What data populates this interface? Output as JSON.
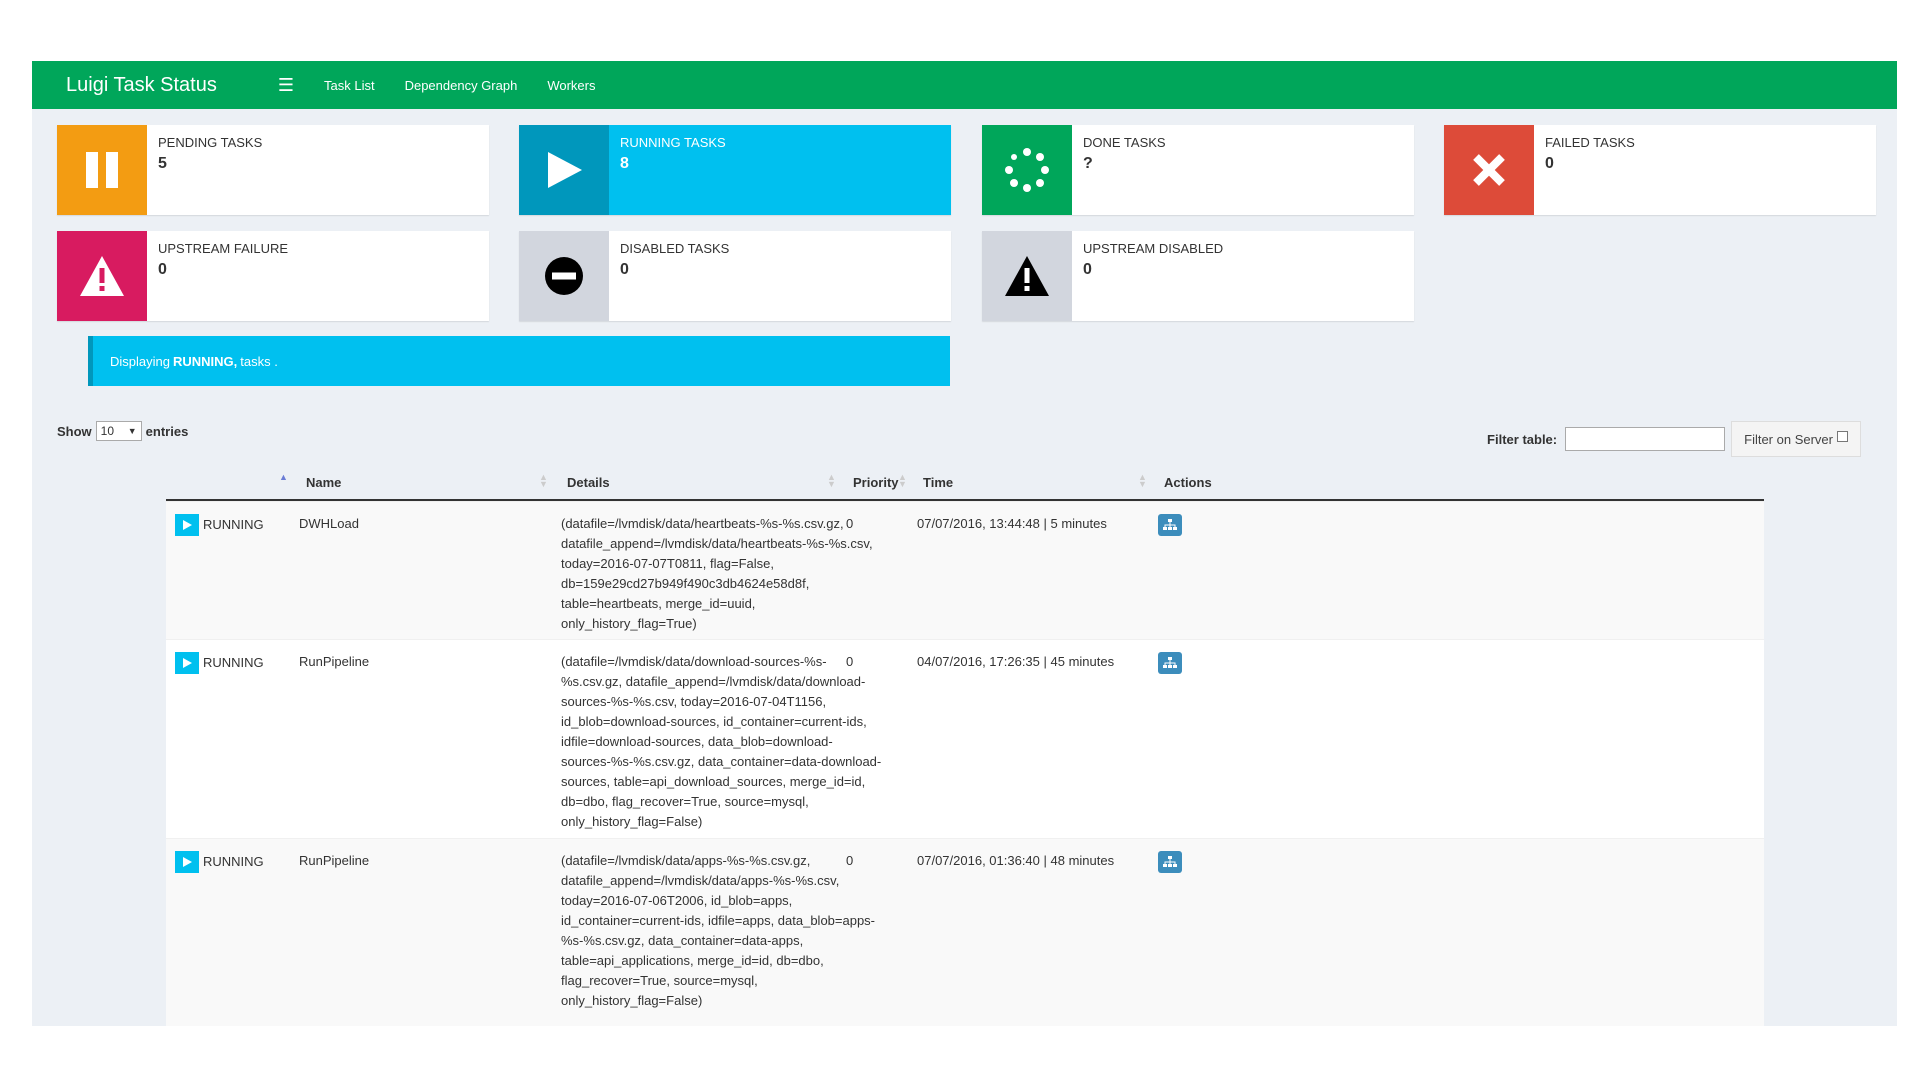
{
  "navbar": {
    "brand": "Luigi Task Status",
    "menu_icon": "hamburger-icon",
    "links": [
      "Task List",
      "Dependency Graph",
      "Workers"
    ]
  },
  "colors": {
    "navbar": "#00a65a",
    "pending": "#f39c12",
    "running": "#00c0ef",
    "done": "#00a65a",
    "failed": "#dd4b39",
    "upstream_failure": "#d81b60",
    "disabled": "#d2d6de"
  },
  "boxes": [
    {
      "label": "PENDING TASKS",
      "value": "5",
      "icon": "pause-icon"
    },
    {
      "label": "RUNNING TASKS",
      "value": "8",
      "icon": "play-icon"
    },
    {
      "label": "DONE TASKS",
      "value": "?",
      "icon": "spinner-icon"
    },
    {
      "label": "FAILED TASKS",
      "value": "0",
      "icon": "x-icon"
    },
    {
      "label": "UPSTREAM FAILURE",
      "value": "0",
      "icon": "warning-icon"
    },
    {
      "label": "DISABLED TASKS",
      "value": "0",
      "icon": "minus-circle-icon"
    },
    {
      "label": "UPSTREAM DISABLED",
      "value": "0",
      "icon": "warning-icon"
    }
  ],
  "callout": {
    "prefix": "Displaying",
    "status": "RUNNING,",
    "suffix": "tasks ."
  },
  "table_controls": {
    "show_label": "Show",
    "entries_value": "10",
    "entries_label": "entries",
    "filter_label": "Filter table:",
    "filter_button": "Filter on Server"
  },
  "columns": [
    "Name",
    "Details",
    "Priority",
    "Time",
    "Actions"
  ],
  "rows": [
    {
      "status": "RUNNING",
      "name": "DWHLoad",
      "details": [
        "(datafile=/lvmdisk/data/heartbeats-%s-%s.csv.gz,",
        "datafile_append=/lvmdisk/data/heartbeats-%s-%s.csv,",
        "today=2016-07-07T0811, flag=False,",
        "db=159e29cd27b949f490c3db4624e58d8f,",
        "table=heartbeats, merge_id=uuid,",
        "only_history_flag=True)"
      ],
      "priority": "0",
      "time": "07/07/2016, 13:44:48 | 5 minutes"
    },
    {
      "status": "RUNNING",
      "name": "RunPipeline",
      "details": [
        "(datafile=/lvmdisk/data/download-sources-%s-",
        "%s.csv.gz, datafile_append=/lvmdisk/data/download-",
        "sources-%s-%s.csv, today=2016-07-04T1156,",
        "id_blob=download-sources, id_container=current-ids,",
        "idfile=download-sources, data_blob=download-",
        "sources-%s-%s.csv.gz, data_container=data-download-",
        "sources, table=api_download_sources, merge_id=id,",
        "db=dbo, flag_recover=True, source=mysql,",
        "only_history_flag=False)"
      ],
      "priority": "0",
      "time": "04/07/2016, 17:26:35 | 45 minutes"
    },
    {
      "status": "RUNNING",
      "name": "RunPipeline",
      "details": [
        "(datafile=/lvmdisk/data/apps-%s-%s.csv.gz,",
        "datafile_append=/lvmdisk/data/apps-%s-%s.csv,",
        "today=2016-07-06T2006, id_blob=apps,",
        "id_container=current-ids, idfile=apps, data_blob=apps-",
        "%s-%s.csv.gz, data_container=data-apps,",
        "table=api_applications, merge_id=id, db=dbo,",
        "flag_recover=True, source=mysql,",
        "only_history_flag=False)"
      ],
      "priority": "0",
      "time": "07/07/2016, 01:36:40 | 48 minutes"
    }
  ]
}
